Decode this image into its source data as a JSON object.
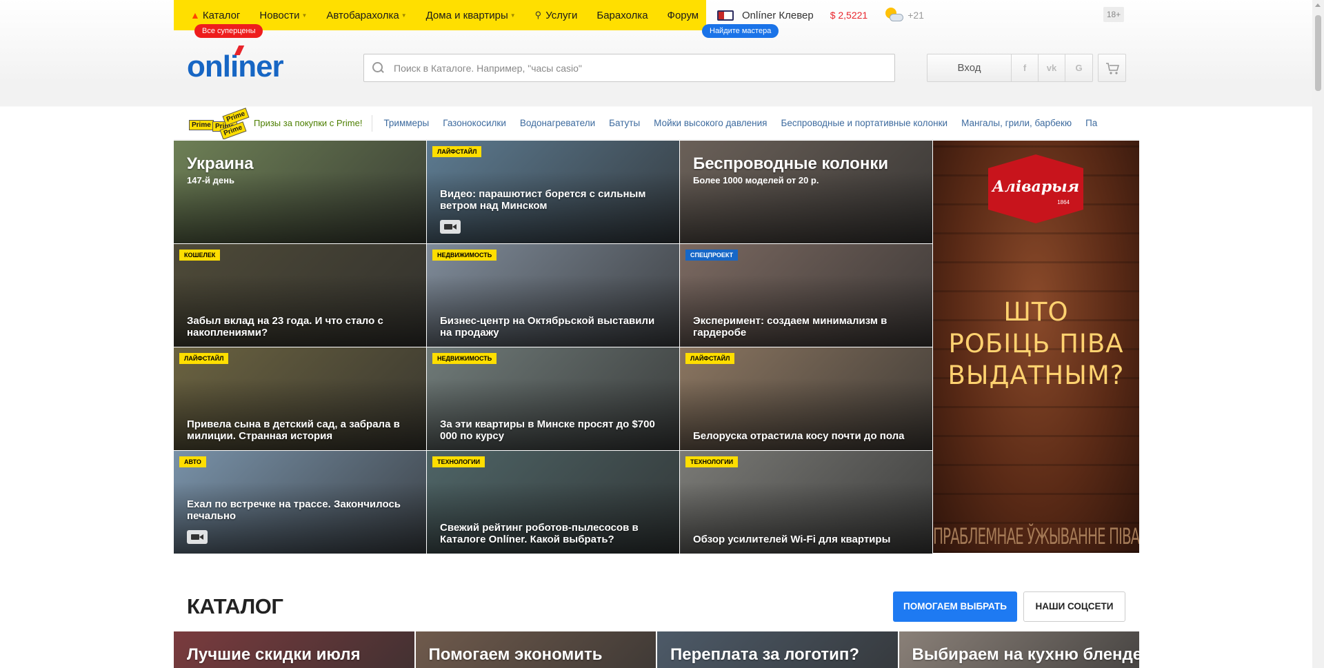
{
  "topnav": {
    "items": [
      {
        "label": "Каталог",
        "has_flame": true,
        "has_chevron": false
      },
      {
        "label": "Новости",
        "has_chevron": true
      },
      {
        "label": "Автобарахолка",
        "has_chevron": true
      },
      {
        "label": "Дома и квартиры",
        "has_chevron": true
      },
      {
        "label": "Услуги",
        "has_magnifier": true,
        "has_chevron": false
      },
      {
        "label": "Барахолка",
        "has_chevron": false
      },
      {
        "label": "Форум",
        "has_chevron": false
      }
    ],
    "badge_catalog": "Все суперцены",
    "badge_services": "Найдите мастера",
    "clever": "Onlíner Клевер",
    "rate": "$ 2,5221",
    "temperature": "+21",
    "age": "18+",
    "accent_color": "#ffdf00"
  },
  "header": {
    "logo": "onliner",
    "search_placeholder": "Поиск в Каталоге. Например, \"часы casio\"",
    "login_label": "Вход",
    "social": [
      "f",
      "vk",
      "G"
    ]
  },
  "promo": {
    "prime_logo_words": [
      "Prime",
      "Prime",
      "Prime",
      "Prime"
    ],
    "prime_text": "Призы за покупки с Prime!",
    "links": [
      "Триммеры",
      "Газонокосилки",
      "Водонагреватели",
      "Батуты",
      "Мойки высокого давления",
      "Беспроводные и портативные колонки",
      "Мангалы, грили, барбекю",
      "Па"
    ]
  },
  "news": [
    {
      "tag": "",
      "title": "Украина",
      "subtitle": "147-й день",
      "big": true,
      "video": false,
      "bg": "#6d7f55"
    },
    {
      "tag": "Лайфстайл",
      "title": "Видео: парашютист борется с сильным ветром над Минском",
      "video": true,
      "bg": "#5c7a90"
    },
    {
      "tag": "",
      "title": "Беспроводные колонки",
      "subtitle": "Более 1000 моделей от 20 р.",
      "big": true,
      "video": false,
      "bg": "#6a6058"
    },
    {
      "tag": "Кошелек",
      "title": "Забыл вклад на 23 года. И что стало с накоплениями?",
      "video": false,
      "bg": "#4e4a38"
    },
    {
      "tag": "Недвижимость",
      "title": "Бизнес-центр на Октябрьской выставили на продажу",
      "video": false,
      "bg": "#7e8a98"
    },
    {
      "tag": "Спецпроект",
      "tag_blue": true,
      "title": "Эксперимент: создаем минимализм в гардеробе",
      "video": false,
      "bg": "#7a6860"
    },
    {
      "tag": "Лайфстайл",
      "title": "Привела сына в детский сад, а забрала в милиции. Странная история",
      "video": false,
      "bg": "#6a6240"
    },
    {
      "tag": "Недвижимость",
      "title": "За эти квартиры в Минске просят до $700 000 по курсу",
      "video": false,
      "bg": "#6f7a78"
    },
    {
      "tag": "Лайфстайл",
      "title": "Белоруска отрастила косу почти до пола",
      "video": false,
      "bg": "#8a7560"
    },
    {
      "tag": "Авто",
      "title": "Ехал по встречке на трассе. Закончилось печально",
      "video": true,
      "bg": "#7891a8"
    },
    {
      "tag": "Технологии",
      "title": "Свежий рейтинг роботов-пылесосов в Каталоге Onlíner. Какой выбрать?",
      "video": false,
      "bg": "#4e6466"
    },
    {
      "tag": "Технологии",
      "title": "Обзор усилителей Wi-Fi для квартиры",
      "video": false,
      "bg": "#7a7a76"
    }
  ],
  "ad": {
    "brand": "Аліварыя",
    "year": "1864",
    "headline_lines": [
      "ШТО",
      "РОБІЦЬ ПІВА",
      "ВЫДАТНЫМ?"
    ],
    "disclaimer": "ПРАБЛЕМНАЕ ЎЖЫВАННЕ ПІВА ШКОДЗІЦЬ ВАШАМУ ЗДАРОЎЮ"
  },
  "catalog": {
    "title": "КАТАЛОГ",
    "btn_primary": "ПОМОГАЕМ ВЫБРАТЬ",
    "btn_secondary": "НАШИ СОЦСЕТИ",
    "cards": [
      {
        "title": "Лучшие скидки июля",
        "bg": "#7a3b3e"
      },
      {
        "title": "Помогаем экономить",
        "bg": "#6f5a4c"
      },
      {
        "title": "Переплата за логотип?",
        "bg": "#4d5a68"
      },
      {
        "title": "Выбираем на кухню блендер",
        "bg": "#8a8078"
      }
    ]
  }
}
